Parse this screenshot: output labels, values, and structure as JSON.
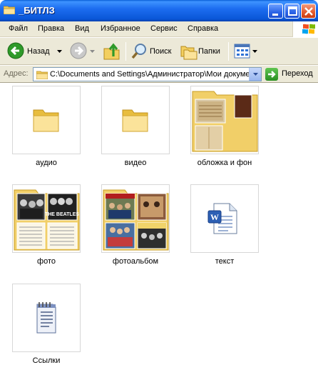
{
  "window": {
    "title": "_БИТЛЗ"
  },
  "menu": {
    "items": [
      "Файл",
      "Правка",
      "Вид",
      "Избранное",
      "Сервис",
      "Справка"
    ]
  },
  "toolbar": {
    "back_label": "Назад",
    "search_label": "Поиск",
    "folders_label": "Папки"
  },
  "address": {
    "label": "Адрес:",
    "path": "C:\\Documents and Settings\\Администратор\\Мои документы\\_БИТЛЗ",
    "go_label": "Переход"
  },
  "items": [
    {
      "name": "аудио",
      "type": "folder"
    },
    {
      "name": "видео",
      "type": "folder"
    },
    {
      "name": "обложка и фон",
      "type": "folder-preview"
    },
    {
      "name": "фото",
      "type": "folder-preview"
    },
    {
      "name": "фотоальбом",
      "type": "folder-preview"
    },
    {
      "name": "текст",
      "type": "word-document"
    },
    {
      "name": "Ссылки",
      "type": "text-document"
    }
  ],
  "thumb_text": {
    "beatles_logo": "THE BEATLES"
  },
  "colors": {
    "titlebar": "#0a57d8",
    "menubar": "#ece9d8",
    "folder": "#f4d77a"
  }
}
